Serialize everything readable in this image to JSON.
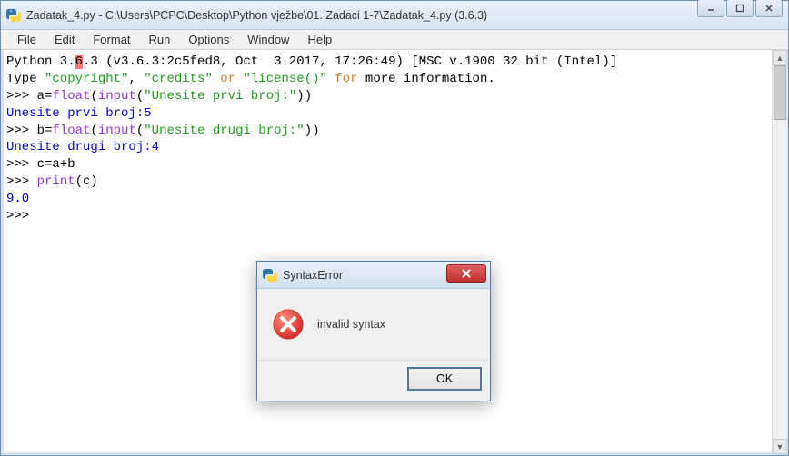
{
  "window": {
    "title": "Zadatak_4.py - C:\\Users\\PCPC\\Desktop\\Python vježbe\\01. Zadaci 1-7\\Zadatak_4.py (3.6.3)"
  },
  "menu": {
    "file": "File",
    "edit": "Edit",
    "format": "Format",
    "run": "Run",
    "options": "Options",
    "window": "Window",
    "help": "Help"
  },
  "editor": {
    "l1a": "Python 3.",
    "l1err": "6",
    "l1b": ".3 (v3.6.3:2c5fed8, Oct  3 2017, 17:26:49) [MSC v.1900 32 bit (Intel)]",
    "l2a": "Type ",
    "l2b": "\"copyright\"",
    "l2c": ", ",
    "l2d": "\"credits\"",
    "l2e": " or ",
    "l2f": "\"license()\"",
    "l2g": " for ",
    "l2h": "more information.",
    "l3a": ">>> a=",
    "l3b": "float",
    "l3c": "(",
    "l3d": "input",
    "l3e": "(",
    "l3f": "\"Unesite prvi broj:\"",
    "l3g": "))",
    "l4": "Unesite prvi broj:5",
    "l5a": ">>> b=",
    "l5b": "float",
    "l5c": "(",
    "l5d": "input",
    "l5e": "(",
    "l5f": "\"Unesite drugi broj:\"",
    "l5g": "))",
    "l6": "Unesite drugi broj:4",
    "l7": ">>> c=a+b",
    "l8a": ">>> ",
    "l8b": "print",
    "l8c": "(c)",
    "l9": "9.0",
    "l10": ">>> "
  },
  "dialog": {
    "title": "SyntaxError",
    "message": "invalid syntax",
    "ok": "OK"
  }
}
